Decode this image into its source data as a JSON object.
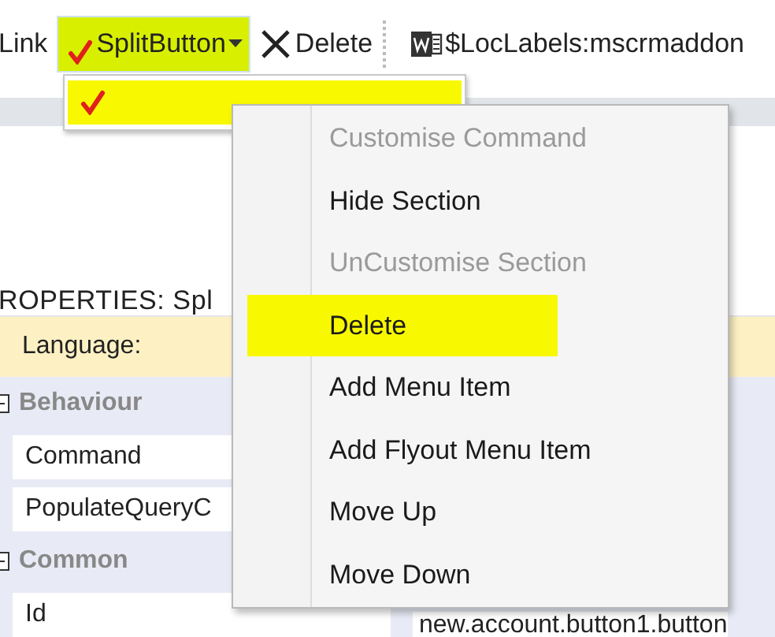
{
  "toolbar": {
    "items": [
      {
        "kind": "link",
        "label": "Link"
      },
      {
        "kind": "split",
        "label": "SplitButton",
        "highlighted": true,
        "checked": true
      },
      {
        "kind": "delete",
        "label": "Delete"
      },
      {
        "kind": "separator"
      },
      {
        "kind": "word",
        "label": "$LocLabels:mscrmaddon"
      }
    ]
  },
  "dropdown": {
    "items": [
      {
        "checked": true,
        "highlighted": true
      }
    ]
  },
  "properties": {
    "title": "ROPERTIES: Spl",
    "rows": [
      {
        "kind": "language",
        "label": "Language:"
      },
      {
        "kind": "group",
        "label": "Behaviour",
        "expanded": true
      },
      {
        "kind": "field",
        "label": "Command"
      },
      {
        "kind": "field",
        "label": "PopulateQueryC"
      },
      {
        "kind": "group",
        "label": "Common",
        "expanded": true
      },
      {
        "kind": "field",
        "label": "Id",
        "value": "new.account.button1.button"
      }
    ]
  },
  "context_menu": {
    "items": [
      {
        "label": "Customise Command",
        "disabled": true,
        "highlighted": false
      },
      {
        "label": "Hide Section",
        "disabled": false,
        "highlighted": false
      },
      {
        "label": "UnCustomise Section",
        "disabled": true,
        "highlighted": false
      },
      {
        "label": "Delete",
        "disabled": false,
        "highlighted": true
      },
      {
        "label": "Add Menu Item",
        "disabled": false,
        "highlighted": false
      },
      {
        "label": "Add Flyout Menu Item",
        "disabled": false,
        "highlighted": false
      },
      {
        "label": "Move Up",
        "disabled": false,
        "highlighted": false
      },
      {
        "label": "Move Down",
        "disabled": false,
        "highlighted": false
      }
    ]
  }
}
